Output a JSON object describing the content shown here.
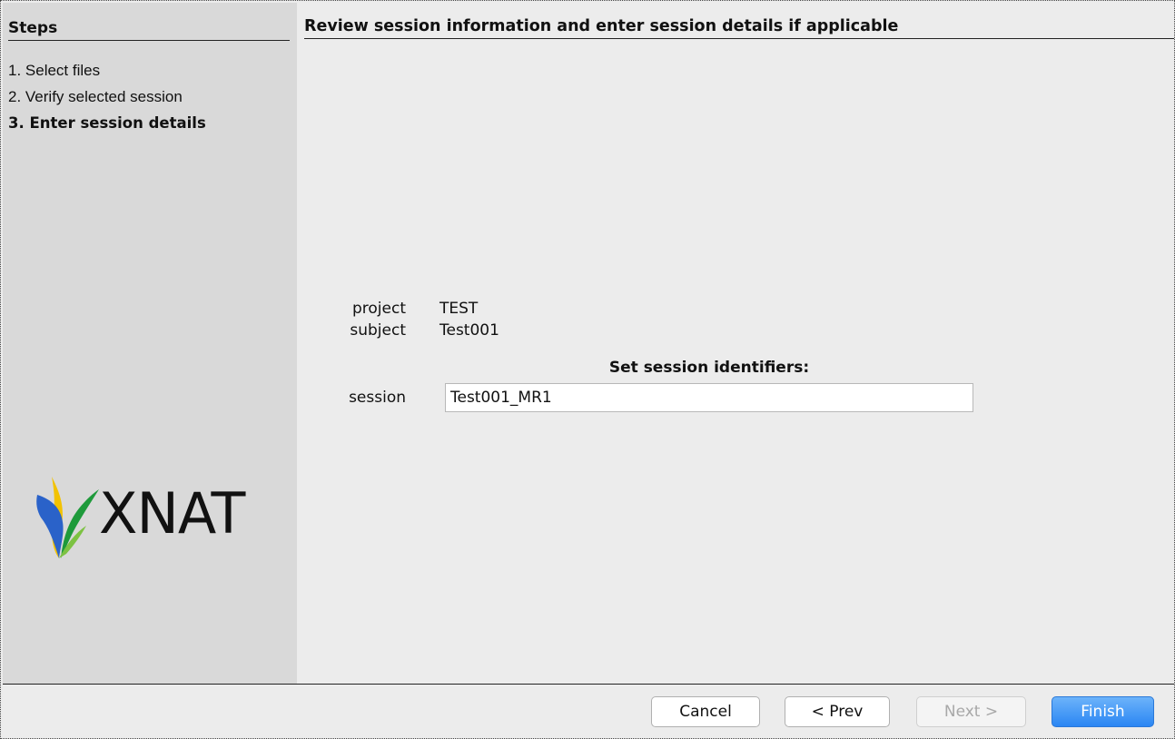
{
  "sidebar": {
    "title": "Steps",
    "steps": [
      {
        "label": "1. Select files",
        "active": false
      },
      {
        "label": "2. Verify selected session",
        "active": false
      },
      {
        "label": "3. Enter session details",
        "active": true
      }
    ],
    "logo_text": "XNAT"
  },
  "main": {
    "title": "Review session information and enter session details if applicable",
    "project_label": "project",
    "project_value": "TEST",
    "subject_label": "subject",
    "subject_value": "Test001",
    "identifiers_heading": "Set session identifiers:",
    "session_label": "session",
    "session_value": "Test001_MR1"
  },
  "buttons": {
    "cancel": "Cancel",
    "prev": "< Prev",
    "next": "Next >",
    "finish": "Finish"
  },
  "colors": {
    "sidebar_bg": "#d9d9d9",
    "main_bg": "#ececec",
    "primary_button": "#2b86f3"
  }
}
